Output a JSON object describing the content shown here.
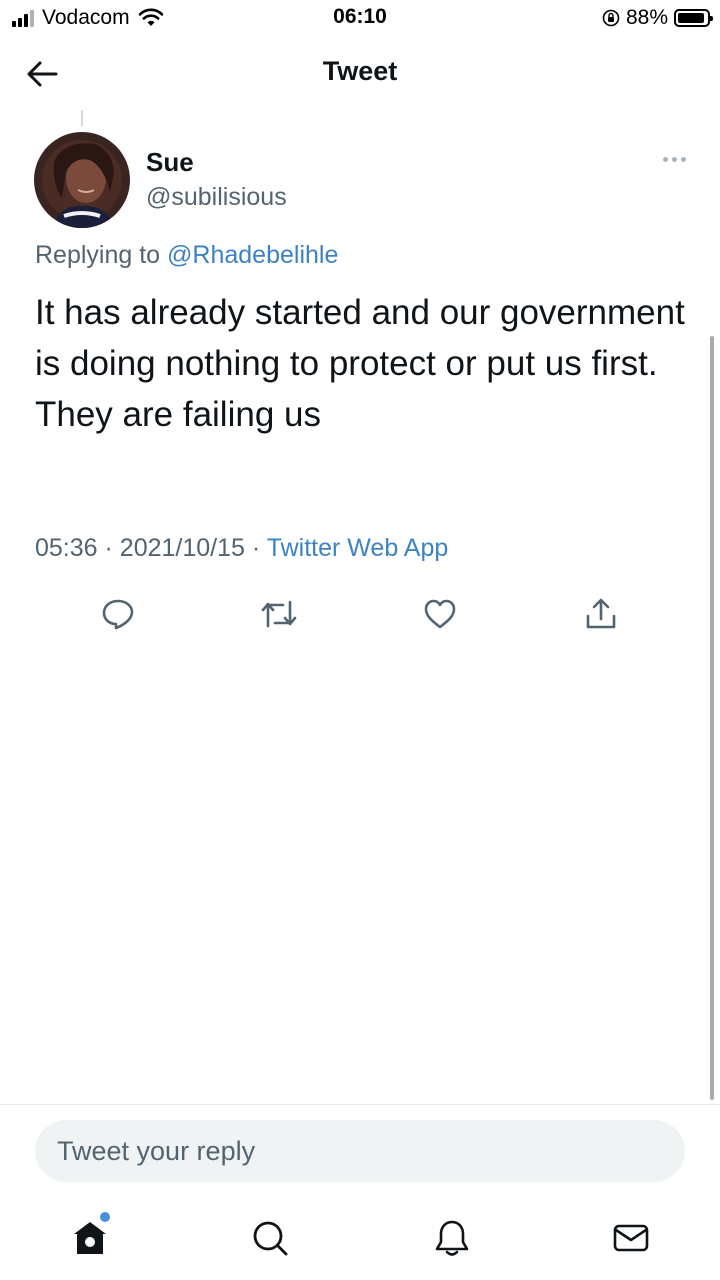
{
  "status_bar": {
    "carrier": "Vodacom",
    "time": "06:10",
    "battery": "88%"
  },
  "header": {
    "title": "Tweet"
  },
  "tweet": {
    "name": "Sue",
    "handle": "@subilisious",
    "replying_prefix": "Replying to",
    "replying_to": "@Rhadebelihle",
    "text": "It has already started and our government is doing nothing to protect or put us first. They are failing us",
    "time": "05:36",
    "date": "2021/10/15",
    "source": "Twitter Web App",
    "separator": "·"
  },
  "reply": {
    "placeholder": "Tweet your reply"
  },
  "colors": {
    "accent": "#3d82c4",
    "secondary_text": "#536471",
    "icon": "#536471"
  },
  "icons": {
    "actions": [
      "reply-icon",
      "retweet-icon",
      "like-icon",
      "share-icon"
    ],
    "tabs": [
      "home-icon",
      "search-icon",
      "notifications-icon",
      "messages-icon"
    ]
  }
}
